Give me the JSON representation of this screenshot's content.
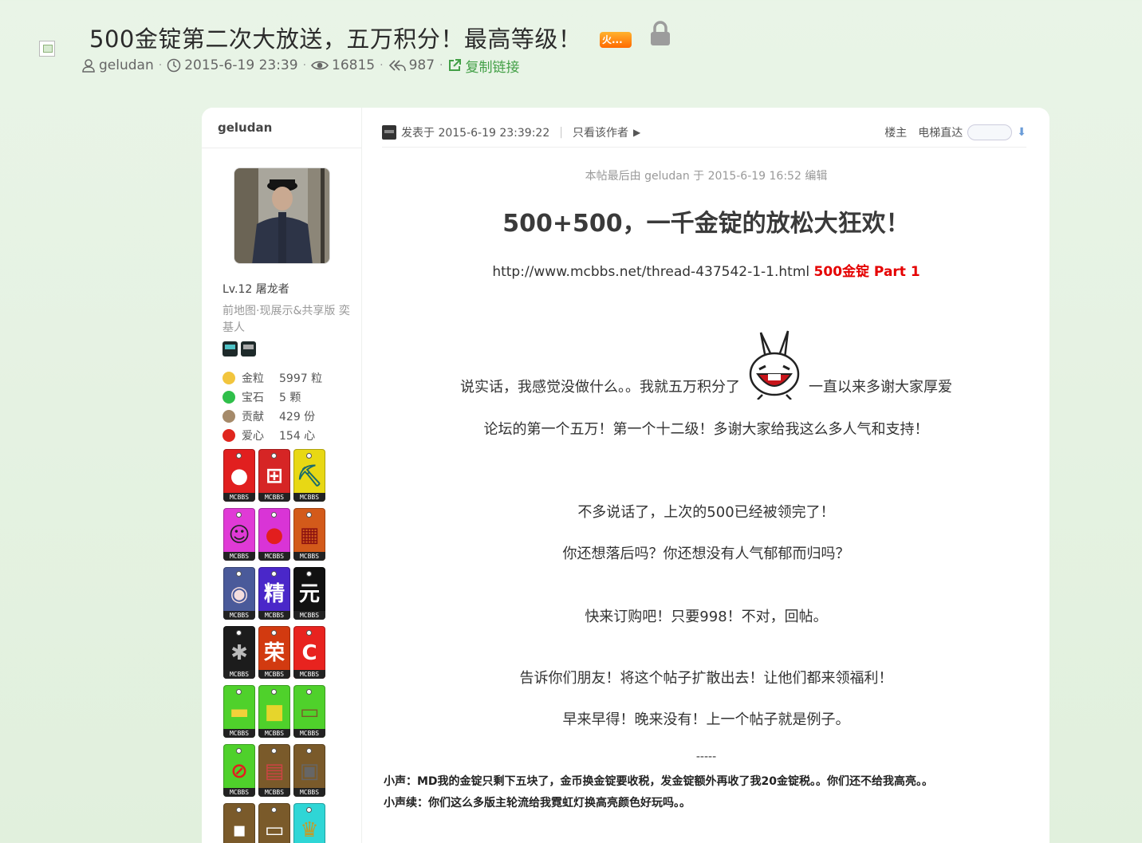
{
  "thread": {
    "title": "500金锭第二次大放送，五万积分！最高等级！",
    "hot_badge": "火...",
    "author": "geludan",
    "datetime": "2015-6-19 23:39",
    "views": "16815",
    "replies": "987",
    "copy_link": "复制链接"
  },
  "sidebar": {
    "username": "geludan",
    "level": "Lv.12 屠龙者",
    "group": "前地图·现展示&共享版 奕基人",
    "stats": [
      {
        "label": "金粒",
        "value": "5997 粒",
        "color": "#f2c53d"
      },
      {
        "label": "宝石",
        "value": "5 颗",
        "color": "#2fbf4a"
      },
      {
        "label": "贡献",
        "value": "429 份",
        "color": "#a58a6a"
      },
      {
        "label": "爱心",
        "value": "154 心",
        "color": "#e0261e"
      }
    ],
    "medal_tag": "MCBBS"
  },
  "post": {
    "posted_at": "发表于 2015-6-19 23:39:22",
    "only_author": "只看该作者",
    "floor": "楼主",
    "elevator": "电梯直达",
    "edit_note": "本帖最后由 geludan 于 2015-6-19 16:52 编辑",
    "heading": "500+500，一千金锭的放松大狂欢！",
    "link_url": "http://www.mcbbs.net/thread-437542-1-1.html",
    "link_label": "500金锭 Part 1",
    "p1_a": "说实话，我感觉没做什么。。我就五万积分了",
    "p1_b": "一直以来多谢大家厚爱",
    "p2": "论坛的第一个五万！第一个十二级！多谢大家给我这么多人气和支持！",
    "p3": "不多说话了，上次的500已经被领完了！",
    "p4": "你还想落后吗？你还想没有人气郁郁而归吗？",
    "p5": "快来订购吧！只要998！不对，回帖。",
    "p6": "告诉你们朋友！将这个帖子扩散出去！让他们都来领福利！",
    "p7": "早来早得！晚来没有！上一个帖子就是例子。",
    "dashes": "-----",
    "note1": "小声：MD我的金锭只剩下五块了，金币换金锭要收税，发金锭额外再收了我20金锭税。。你们还不给我高亮。。",
    "note2": "小声续：你们这么多版主轮流给我霓虹灯换高亮颜色好玩吗。。"
  }
}
